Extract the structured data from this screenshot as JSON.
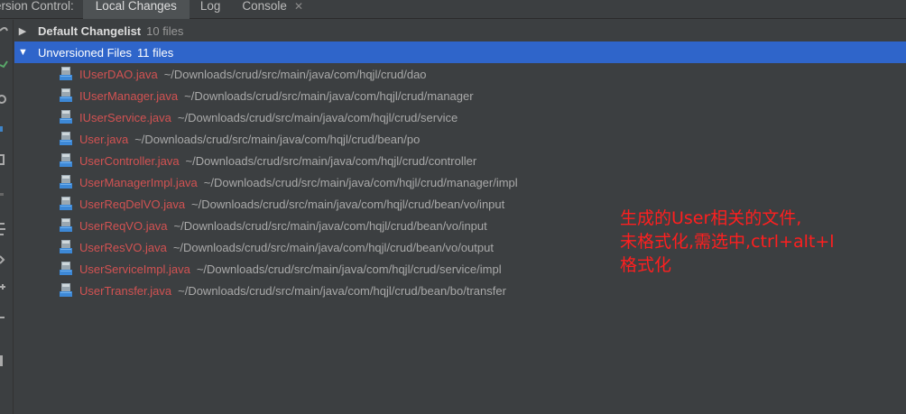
{
  "header": {
    "vc_label": "ersion Control:",
    "tabs": [
      {
        "label": "Local Changes",
        "active": true
      },
      {
        "label": "Log",
        "active": false
      },
      {
        "label": "Console",
        "active": false,
        "closable": true
      }
    ],
    "close_glyph": "✕"
  },
  "changelists": [
    {
      "name": "Default Changelist",
      "count": "10 files",
      "expanded": false,
      "selected": false
    },
    {
      "name": "Unversioned Files",
      "count": "11 files",
      "expanded": true,
      "selected": true
    }
  ],
  "files": [
    {
      "name": "IUserDAO.java",
      "path": "~/Downloads/crud/src/main/java/com/hqjl/crud/dao"
    },
    {
      "name": "IUserManager.java",
      "path": "~/Downloads/crud/src/main/java/com/hqjl/crud/manager"
    },
    {
      "name": "IUserService.java",
      "path": "~/Downloads/crud/src/main/java/com/hqjl/crud/service"
    },
    {
      "name": "User.java",
      "path": "~/Downloads/crud/src/main/java/com/hqjl/crud/bean/po"
    },
    {
      "name": "UserController.java",
      "path": "~/Downloads/crud/src/main/java/com/hqjl/crud/controller"
    },
    {
      "name": "UserManagerImpl.java",
      "path": "~/Downloads/crud/src/main/java/com/hqjl/crud/manager/impl"
    },
    {
      "name": "UserReqDelVO.java",
      "path": "~/Downloads/crud/src/main/java/com/hqjl/crud/bean/vo/input"
    },
    {
      "name": "UserReqVO.java",
      "path": "~/Downloads/crud/src/main/java/com/hqjl/crud/bean/vo/input"
    },
    {
      "name": "UserResVO.java",
      "path": "~/Downloads/crud/src/main/java/com/hqjl/crud/bean/vo/output"
    },
    {
      "name": "UserServiceImpl.java",
      "path": "~/Downloads/crud/src/main/java/com/hqjl/crud/service/impl"
    },
    {
      "name": "UserTransfer.java",
      "path": "~/Downloads/crud/src/main/java/com/hqjl/crud/bean/bo/transfer"
    }
  ],
  "annotation": {
    "lines": [
      "生成的User相关的文件,",
      "未格式化,需选中,ctrl+alt+l",
      "格式化"
    ]
  },
  "colors": {
    "background": "#3c3f41",
    "selection": "#2f65ca",
    "unversioned_file": "#d25252",
    "path_text": "#a9a9a9",
    "annotation": "#ff1f1f"
  },
  "icons": {
    "collapsed": "▶",
    "expanded": "▼",
    "file": "java-file-icon"
  }
}
